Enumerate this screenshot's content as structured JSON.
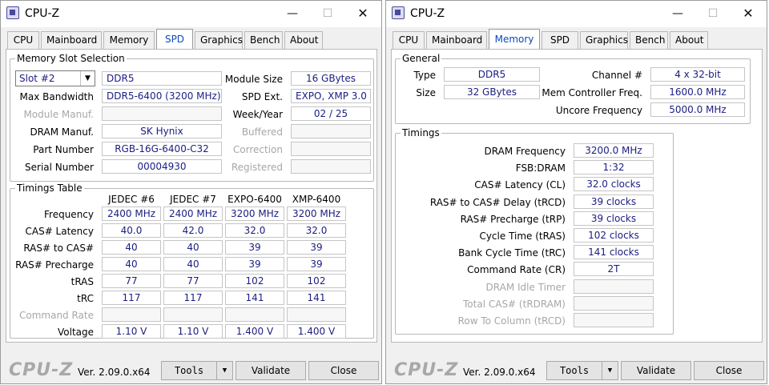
{
  "app": {
    "title": "CPU-Z",
    "logo": "CPU-Z",
    "version": "Ver. 2.09.0.x64",
    "buttons": {
      "tools": "Tools",
      "validate": "Validate",
      "close": "Close"
    },
    "window_controls": {
      "minimize": "—",
      "maximize": "☐",
      "close": "✕"
    }
  },
  "tabs": [
    "CPU",
    "Mainboard",
    "Memory",
    "SPD",
    "Graphics",
    "Bench",
    "About"
  ],
  "spd": {
    "active_tab": "SPD",
    "slot_group_title": "Memory Slot Selection",
    "slot_selected": "Slot #2",
    "mem_type": "DDR5",
    "labels": {
      "module_size": "Module Size",
      "max_bandwidth": "Max Bandwidth",
      "spd_ext": "SPD Ext.",
      "module_manuf": "Module Manuf.",
      "week_year": "Week/Year",
      "dram_manuf": "DRAM Manuf.",
      "buffered": "Buffered",
      "part_number": "Part Number",
      "correction": "Correction",
      "serial_number": "Serial Number",
      "registered": "Registered"
    },
    "values": {
      "module_size": "16 GBytes",
      "max_bandwidth": "DDR5-6400 (3200 MHz)",
      "spd_ext": "EXPO, XMP 3.0",
      "module_manuf": "",
      "week_year": "02 / 25",
      "dram_manuf": "SK Hynix",
      "buffered": "",
      "part_number": "RGB-16G-6400-C32",
      "correction": "",
      "serial_number": "00004930",
      "registered": ""
    },
    "timings_title": "Timings Table",
    "columns": [
      "JEDEC #6",
      "JEDEC #7",
      "EXPO-6400",
      "XMP-6400"
    ],
    "rows": [
      {
        "label": "Frequency",
        "values": [
          "2400 MHz",
          "2400 MHz",
          "3200 MHz",
          "3200 MHz"
        ]
      },
      {
        "label": "CAS# Latency",
        "values": [
          "40.0",
          "42.0",
          "32.0",
          "32.0"
        ]
      },
      {
        "label": "RAS# to CAS#",
        "values": [
          "40",
          "40",
          "39",
          "39"
        ]
      },
      {
        "label": "RAS# Precharge",
        "values": [
          "40",
          "40",
          "39",
          "39"
        ]
      },
      {
        "label": "tRAS",
        "values": [
          "77",
          "77",
          "102",
          "102"
        ]
      },
      {
        "label": "tRC",
        "values": [
          "117",
          "117",
          "141",
          "141"
        ]
      },
      {
        "label": "Command Rate",
        "values": [
          "",
          "",
          "",
          ""
        ]
      },
      {
        "label": "Voltage",
        "values": [
          "1.10 V",
          "1.10 V",
          "1.400 V",
          "1.400 V"
        ]
      }
    ]
  },
  "memory": {
    "active_tab": "Memory",
    "general_title": "General",
    "labels": {
      "type": "Type",
      "size": "Size",
      "channel": "Channel #",
      "mem_ctrl_freq": "Mem Controller Freq.",
      "uncore_freq": "Uncore Frequency"
    },
    "values": {
      "type": "DDR5",
      "size": "32 GBytes",
      "channel": "4 x 32-bit",
      "mem_ctrl_freq": "1600.0 MHz",
      "uncore_freq": "5000.0 MHz"
    },
    "timings_title": "Timings",
    "timings": [
      {
        "label": "DRAM Frequency",
        "value": "3200.0 MHz"
      },
      {
        "label": "FSB:DRAM",
        "value": "1:32"
      },
      {
        "label": "CAS# Latency (CL)",
        "value": "32.0 clocks"
      },
      {
        "label": "RAS# to CAS# Delay (tRCD)",
        "value": "39 clocks"
      },
      {
        "label": "RAS# Precharge (tRP)",
        "value": "39 clocks"
      },
      {
        "label": "Cycle Time (tRAS)",
        "value": "102 clocks"
      },
      {
        "label": "Bank Cycle Time (tRC)",
        "value": "141 clocks"
      },
      {
        "label": "Command Rate (CR)",
        "value": "2T"
      },
      {
        "label": "DRAM Idle Timer",
        "value": ""
      },
      {
        "label": "Total CAS# (tRDRAM)",
        "value": ""
      },
      {
        "label": "Row To Column (tRCD)",
        "value": ""
      }
    ]
  }
}
